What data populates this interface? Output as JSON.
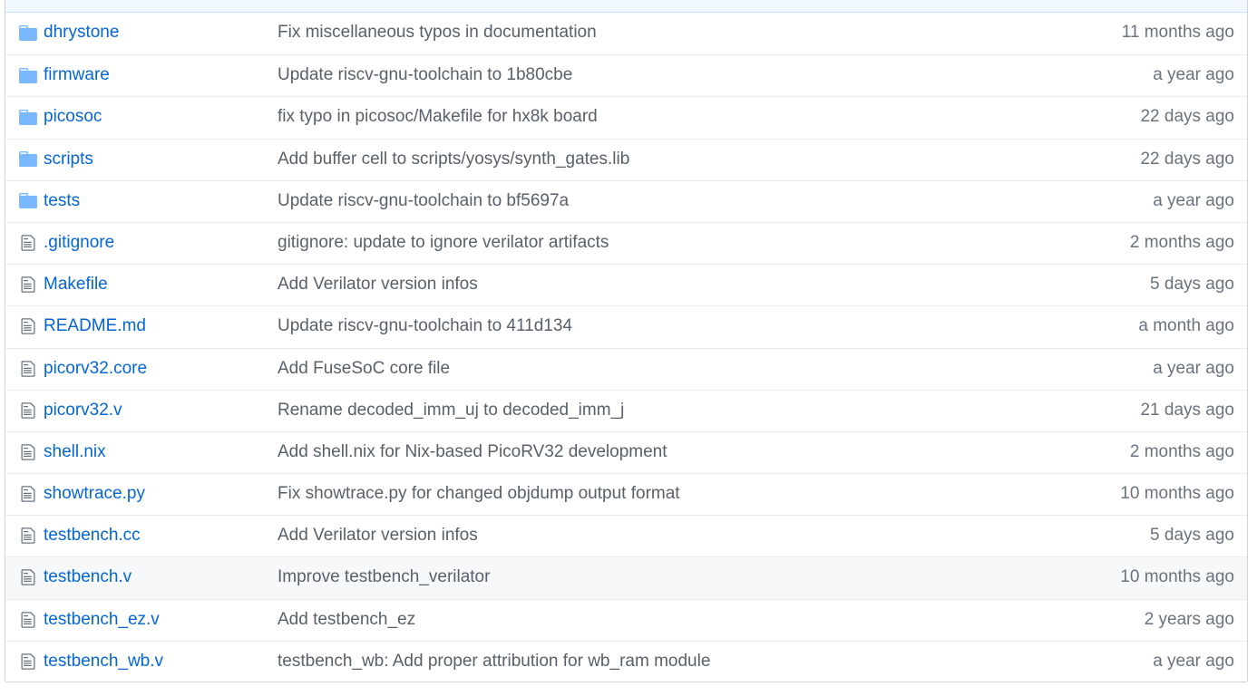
{
  "colors": {
    "link": "#0366d6",
    "message": "#586069",
    "age": "#6a737d",
    "folder_icon": "#79b8ff",
    "file_icon": "#6a737d",
    "header_bg": "#f1f8ff",
    "hover_row_bg": "#f6f8fa"
  },
  "files": [
    {
      "type": "directory",
      "icon": "folder-icon",
      "name": "dhrystone",
      "message": "Fix miscellaneous typos in documentation",
      "age": "11 months ago"
    },
    {
      "type": "directory",
      "icon": "folder-icon",
      "name": "firmware",
      "message": "Update riscv-gnu-toolchain to 1b80cbe",
      "age": "a year ago"
    },
    {
      "type": "directory",
      "icon": "folder-icon",
      "name": "picosoc",
      "message": "fix typo in picosoc/Makefile for hx8k board",
      "age": "22 days ago"
    },
    {
      "type": "directory",
      "icon": "folder-icon",
      "name": "scripts",
      "message": "Add buffer cell to scripts/yosys/synth_gates.lib",
      "age": "22 days ago"
    },
    {
      "type": "directory",
      "icon": "folder-icon",
      "name": "tests",
      "message": "Update riscv-gnu-toolchain to bf5697a",
      "age": "a year ago"
    },
    {
      "type": "file",
      "icon": "file-icon",
      "name": ".gitignore",
      "message": "gitignore: update to ignore verilator artifacts",
      "age": "2 months ago"
    },
    {
      "type": "file",
      "icon": "file-icon",
      "name": "Makefile",
      "message": "Add Verilator version infos",
      "age": "5 days ago"
    },
    {
      "type": "file",
      "icon": "file-icon",
      "name": "README.md",
      "message": "Update riscv-gnu-toolchain to 411d134",
      "age": "a month ago"
    },
    {
      "type": "file",
      "icon": "file-icon",
      "name": "picorv32.core",
      "message": "Add FuseSoC core file",
      "age": "a year ago"
    },
    {
      "type": "file",
      "icon": "file-icon",
      "name": "picorv32.v",
      "message": "Rename decoded_imm_uj to decoded_imm_j",
      "age": "21 days ago"
    },
    {
      "type": "file",
      "icon": "file-icon",
      "name": "shell.nix",
      "message": "Add shell.nix for Nix-based PicoRV32 development",
      "age": "2 months ago"
    },
    {
      "type": "file",
      "icon": "file-icon",
      "name": "showtrace.py",
      "message": "Fix showtrace.py for changed objdump output format",
      "age": "10 months ago"
    },
    {
      "type": "file",
      "icon": "file-icon",
      "name": "testbench.cc",
      "message": "Add Verilator version infos",
      "age": "5 days ago"
    },
    {
      "type": "file",
      "icon": "file-icon",
      "name": "testbench.v",
      "message": "Improve testbench_verilator",
      "age": "10 months ago",
      "hovered": true
    },
    {
      "type": "file",
      "icon": "file-icon",
      "name": "testbench_ez.v",
      "message": "Add testbench_ez",
      "age": "2 years ago"
    },
    {
      "type": "file",
      "icon": "file-icon",
      "name": "testbench_wb.v",
      "message": "testbench_wb: Add proper attribution for wb_ram module",
      "age": "a year ago"
    }
  ]
}
